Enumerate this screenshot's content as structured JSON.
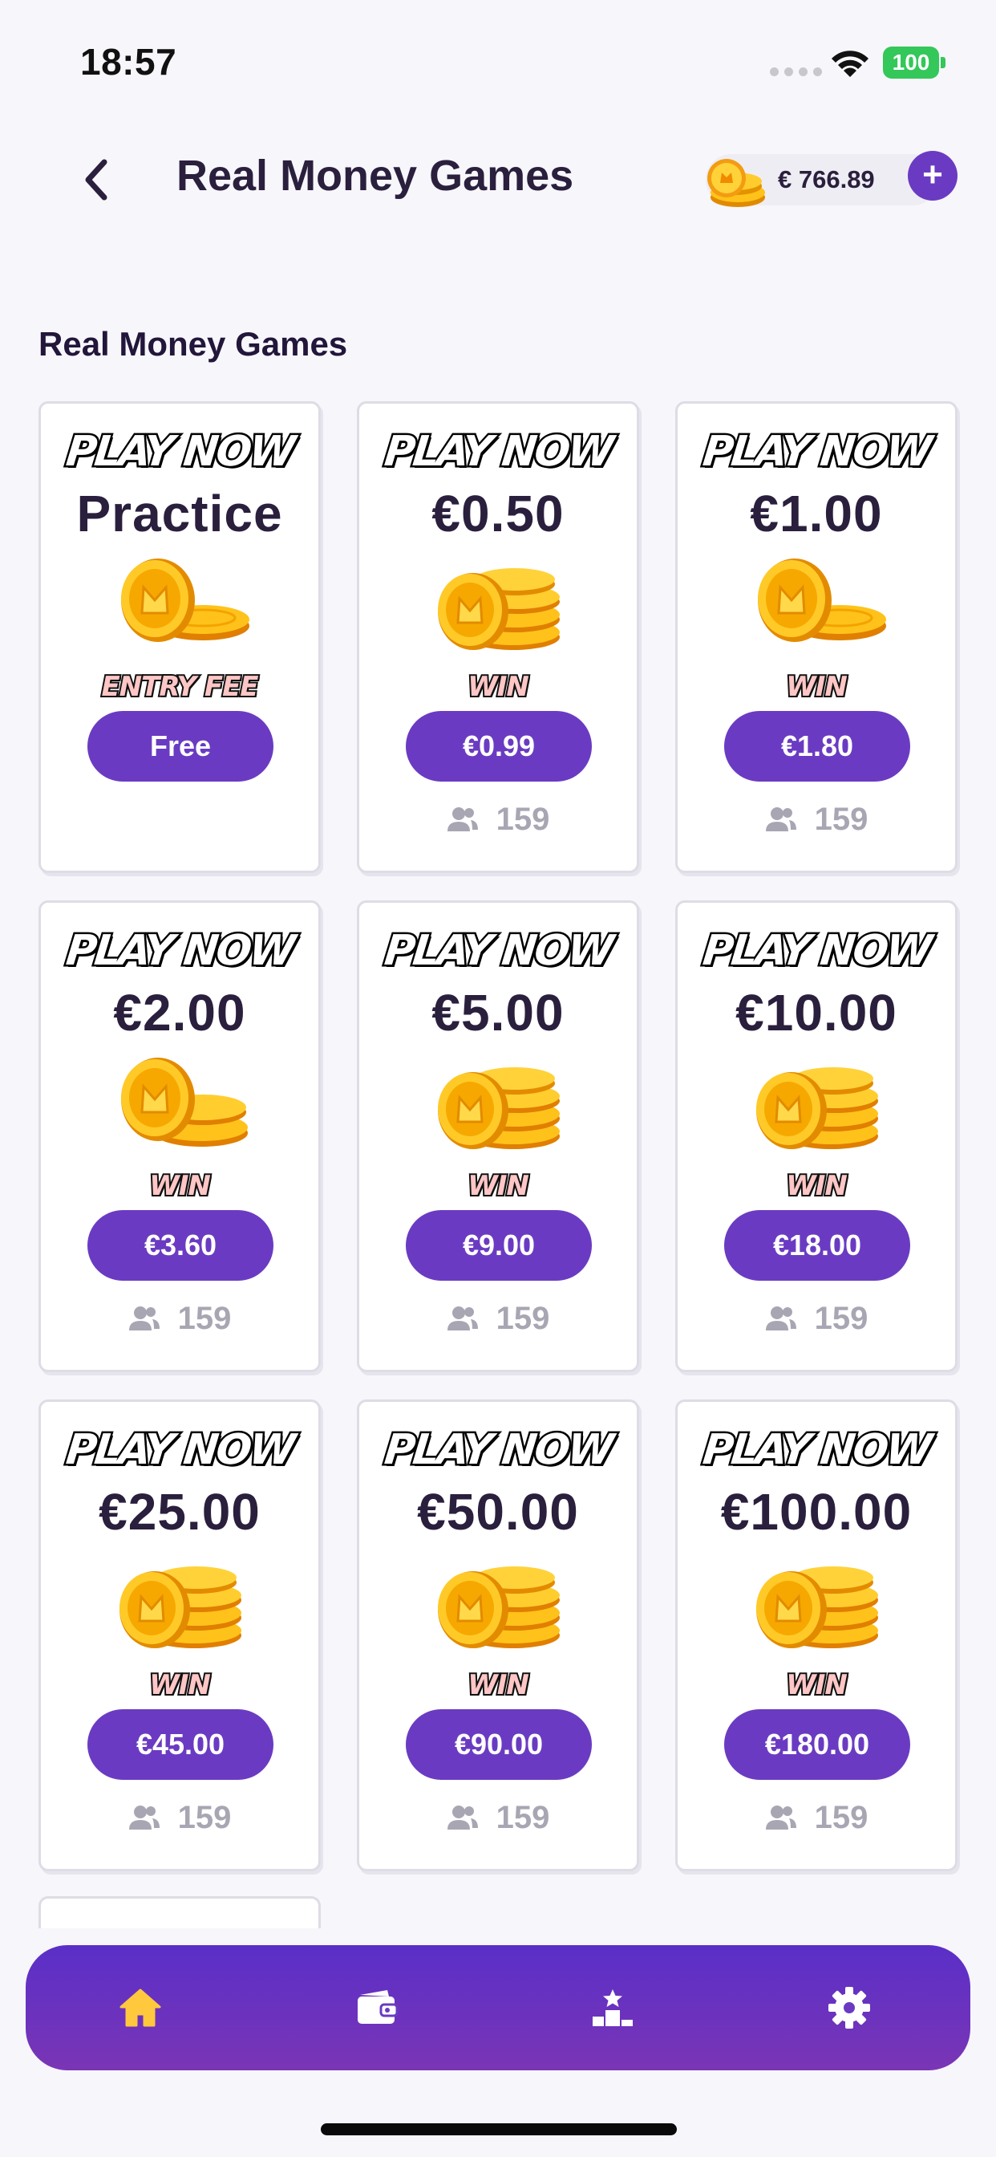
{
  "status_bar": {
    "time": "18:57",
    "battery": "100"
  },
  "header": {
    "title": "Real Money Games",
    "balance": "€ 766.89",
    "add_label": "+"
  },
  "section": {
    "title": "Real Money Games"
  },
  "cards": [
    {
      "badge": "PLAY NOW",
      "stake": "Practice",
      "prize_tag": "ENTRY FEE",
      "prize": "Free",
      "players": ""
    },
    {
      "badge": "PLAY NOW",
      "stake": "€0.50",
      "prize_tag": "WIN",
      "prize": "€0.99",
      "players": "159"
    },
    {
      "badge": "PLAY NOW",
      "stake": "€1.00",
      "prize_tag": "WIN",
      "prize": "€1.80",
      "players": "159"
    },
    {
      "badge": "PLAY NOW",
      "stake": "€2.00",
      "prize_tag": "WIN",
      "prize": "€3.60",
      "players": "159"
    },
    {
      "badge": "PLAY NOW",
      "stake": "€5.00",
      "prize_tag": "WIN",
      "prize": "€9.00",
      "players": "159"
    },
    {
      "badge": "PLAY NOW",
      "stake": "€10.00",
      "prize_tag": "WIN",
      "prize": "€18.00",
      "players": "159"
    },
    {
      "badge": "PLAY NOW",
      "stake": "€25.00",
      "prize_tag": "WIN",
      "prize": "€45.00",
      "players": "159"
    },
    {
      "badge": "PLAY NOW",
      "stake": "€50.00",
      "prize_tag": "WIN",
      "prize": "€90.00",
      "players": "159"
    },
    {
      "badge": "PLAY NOW",
      "stake": "€100.00",
      "prize_tag": "WIN",
      "prize": "€180.00",
      "players": "159"
    }
  ],
  "icons": {
    "back": "chevron-left-icon",
    "balance": "coin-stack-icon",
    "players": "users-icon",
    "nav": [
      "home-icon",
      "wallet-icon",
      "leaderboard-icon",
      "settings-icon"
    ]
  },
  "colors": {
    "accent": "#6a3bc2",
    "nav_active": "#ffc83d",
    "nav_inactive": "#ffffff",
    "battery": "#34c759",
    "muted": "#a9a6b3"
  }
}
